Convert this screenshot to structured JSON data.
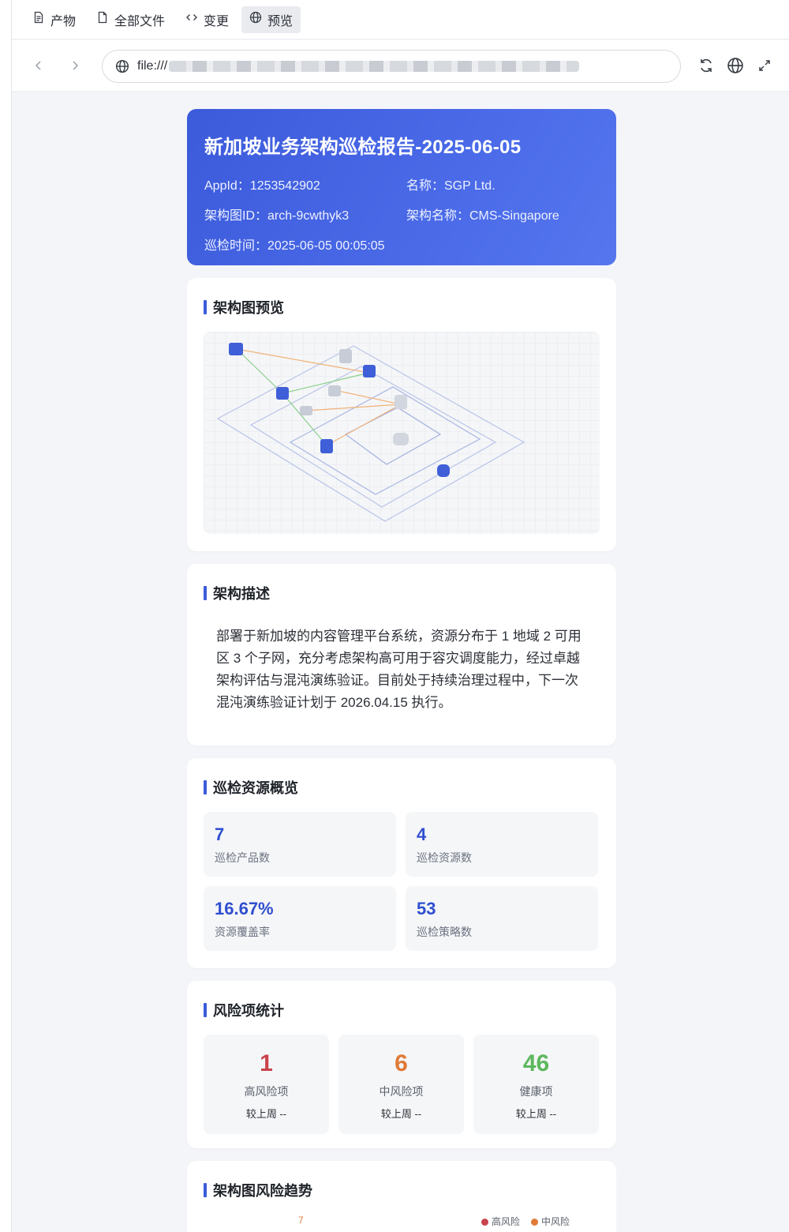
{
  "tabs": [
    {
      "label": "产物",
      "icon": "file-icon"
    },
    {
      "label": "全部文件",
      "icon": "document-icon"
    },
    {
      "label": "变更",
      "icon": "code-icon"
    },
    {
      "label": "预览",
      "icon": "globe-icon",
      "active": true
    }
  ],
  "address": {
    "prefix": "file:///"
  },
  "report": {
    "title": "新加坡业务架构巡检报告-2025-06-05",
    "appid": "AppId：1253542902",
    "name": "名称：SGP Ltd.",
    "arch_id": "架构图ID：arch-9cwthyk3",
    "arch_name": "架构名称：CMS-Singapore",
    "time": "巡检时间：2025-06-05 00:05:05"
  },
  "sections": {
    "preview_title": "架构图预览",
    "desc_title": "架构描述",
    "desc_text": "部署于新加坡的内容管理平台系统，资源分布于 1 地域 2 可用区 3 个子网，充分考虑架构高可用于容灾调度能力，经过卓越架构评估与混沌演练验证。目前处于持续治理过程中，下一次混沌演练验证计划于 2026.04.15 执行。",
    "overview_title": "巡检资源概览",
    "risk_title": "风险项统计",
    "trend_title": "架构图风险趋势"
  },
  "overview": [
    {
      "value": "7",
      "label": "巡检产品数"
    },
    {
      "value": "4",
      "label": "巡检资源数"
    },
    {
      "value": "16.67%",
      "label": "资源覆盖率"
    },
    {
      "value": "53",
      "label": "巡检策略数"
    }
  ],
  "risks": [
    {
      "value": "1",
      "label": "高风险项",
      "compare": "较上周 --",
      "color": "#c9434c"
    },
    {
      "value": "6",
      "label": "中风险项",
      "compare": "较上周 --",
      "color": "#e07a36"
    },
    {
      "value": "46",
      "label": "健康项",
      "compare": "较上周 --",
      "color": "#5cb85c"
    }
  ],
  "trend": {
    "peak_label": "7",
    "legend": [
      {
        "label": "高风险",
        "color": "#c9434c"
      },
      {
        "label": "中风险",
        "color": "#e07a36"
      }
    ]
  }
}
